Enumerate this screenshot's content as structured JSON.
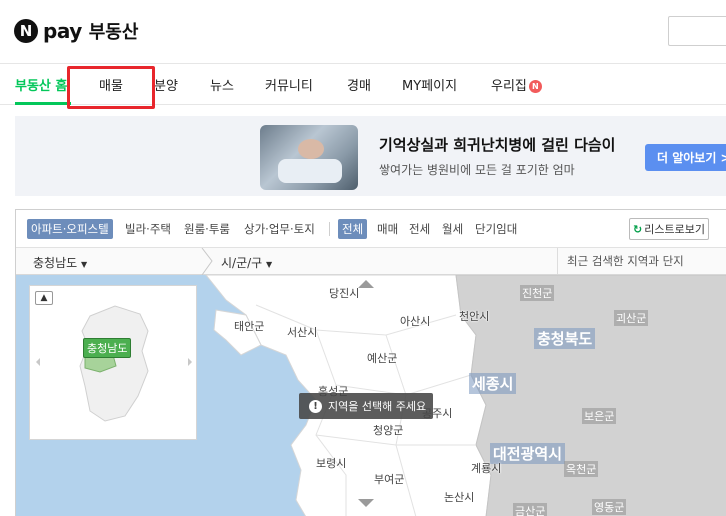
{
  "header": {
    "logo_mark": "N",
    "logo_pay": "pay",
    "logo_title": "부동산"
  },
  "nav": {
    "items": [
      {
        "label": "부동산 홈",
        "active": true
      },
      {
        "label": "매물",
        "active": false
      },
      {
        "label": "분양",
        "active": false
      },
      {
        "label": "뉴스",
        "active": false
      },
      {
        "label": "커뮤니티",
        "active": false
      },
      {
        "label": "경매",
        "active": false
      },
      {
        "label": "MY페이지",
        "active": false
      },
      {
        "label": "우리집",
        "active": false
      }
    ],
    "badge": "N",
    "active_color": "#03c75a",
    "highlight_color": "#e8262c"
  },
  "banner": {
    "title": "기억상실과 희귀난치병에 걸린 다슴이",
    "subtitle": "쌓여가는 병원비에 모든 걸 포기한 엄마",
    "button": "더 알아보기 >"
  },
  "filters": {
    "property_types": [
      "아파트·오피스텔",
      "빌라·주택",
      "원룸·투룸",
      "상가·업무·토지"
    ],
    "property_selected": "아파트·오피스텔",
    "deal_types": [
      "전체",
      "매매",
      "전세",
      "월세",
      "단기임대"
    ],
    "deal_selected": "전체",
    "list_view_button": "리스트로보기",
    "list_view_icon": "refresh-icon"
  },
  "location": {
    "province": "충청남도",
    "city_placeholder": "시/군/구",
    "recent_search": "최근 검색한 지역과 단지"
  },
  "map": {
    "minimap_toggle": "▲",
    "minimap_selected": "충청남도",
    "toast": "지역을 선택해 주세요",
    "labels": {
      "dangjin": "당진시",
      "taean": "태안군",
      "seosan": "서산시",
      "asan": "아산시",
      "cheonan": "천안시",
      "jincheon": "진천군",
      "goesan": "괴산군",
      "chungbuk": "충청북도",
      "yesan": "예산군",
      "sejong": "세종시",
      "hongseong": "홍성군",
      "gongju": "공주시",
      "boeun": "보은군",
      "cheongyang": "청양군",
      "daejeon": "대전광역시",
      "boryeong": "보령시",
      "gyeryong": "계룡시",
      "okcheon": "옥천군",
      "buyeo": "부여군",
      "nonsan": "논산시",
      "yeongdong": "영동군",
      "geumsan": "금산군"
    }
  }
}
